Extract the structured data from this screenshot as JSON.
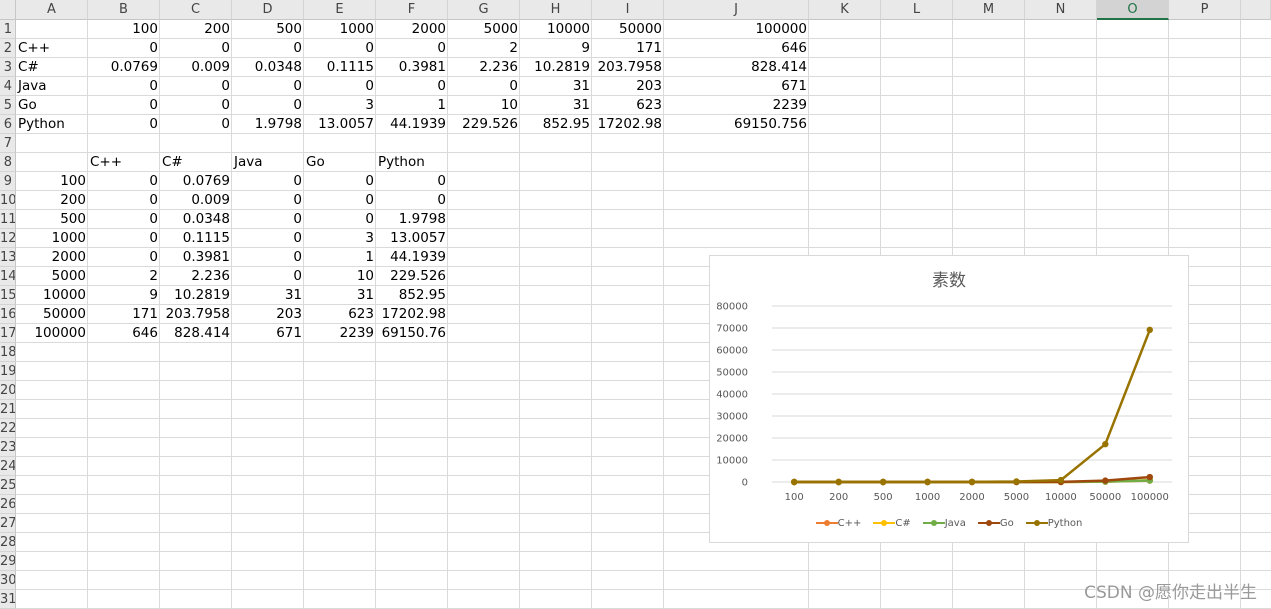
{
  "sheet": {
    "columns": [
      "A",
      "B",
      "C",
      "D",
      "E",
      "F",
      "G",
      "H",
      "I",
      "J",
      "K",
      "L",
      "M",
      "N",
      "O",
      "P"
    ],
    "active_column": "O",
    "rows": [
      "1",
      "2",
      "3",
      "4",
      "5",
      "6",
      "7",
      "8",
      "9",
      "10",
      "11",
      "12",
      "13",
      "14",
      "15",
      "16",
      "17",
      "18",
      "19",
      "20",
      "21",
      "22",
      "23",
      "24",
      "25",
      "26",
      "27",
      "28",
      "29",
      "30",
      "31"
    ],
    "table1": [
      [
        "",
        "100",
        "200",
        "500",
        "1000",
        "2000",
        "5000",
        "10000",
        "50000",
        "100000"
      ],
      [
        "C++",
        "0",
        "0",
        "0",
        "0",
        "0",
        "2",
        "9",
        "171",
        "646"
      ],
      [
        "C#",
        "0.0769",
        "0.009",
        "0.0348",
        "0.1115",
        "0.3981",
        "2.236",
        "10.2819",
        "203.7958",
        "828.414"
      ],
      [
        "Java",
        "0",
        "0",
        "0",
        "0",
        "0",
        "0",
        "31",
        "203",
        "671"
      ],
      [
        "Go",
        "0",
        "0",
        "0",
        "3",
        "1",
        "10",
        "31",
        "623",
        "2239"
      ],
      [
        "Python",
        "0",
        "0",
        "1.9798",
        "13.0057",
        "44.1939",
        "229.526",
        "852.95",
        "17202.98",
        "69150.756"
      ]
    ],
    "table2_header": [
      "",
      "C++",
      "C#",
      "Java",
      "Go",
      "Python"
    ],
    "table2": [
      [
        "100",
        "0",
        "0.0769",
        "0",
        "0",
        "0"
      ],
      [
        "200",
        "0",
        "0.009",
        "0",
        "0",
        "0"
      ],
      [
        "500",
        "0",
        "0.0348",
        "0",
        "0",
        "1.9798"
      ],
      [
        "1000",
        "0",
        "0.1115",
        "0",
        "3",
        "13.0057"
      ],
      [
        "2000",
        "0",
        "0.3981",
        "0",
        "1",
        "44.1939"
      ],
      [
        "5000",
        "2",
        "2.236",
        "0",
        "10",
        "229.526"
      ],
      [
        "10000",
        "9",
        "10.2819",
        "31",
        "31",
        "852.95"
      ],
      [
        "50000",
        "171",
        "203.7958",
        "203",
        "623",
        "17202.98"
      ],
      [
        "100000",
        "646",
        "828.414",
        "671",
        "2239",
        "69150.76"
      ]
    ]
  },
  "chart_data": {
    "type": "line",
    "title": "素数",
    "categories": [
      "100",
      "200",
      "500",
      "1000",
      "2000",
      "5000",
      "10000",
      "50000",
      "100000"
    ],
    "ylim": [
      0,
      80000
    ],
    "yticks": [
      "0",
      "10000",
      "20000",
      "30000",
      "40000",
      "50000",
      "60000",
      "70000",
      "80000"
    ],
    "grid": true,
    "legend_position": "bottom",
    "series": [
      {
        "name": "C++",
        "color": "#ED7D31",
        "values": [
          0,
          0,
          0,
          0,
          0,
          2,
          9,
          171,
          646
        ]
      },
      {
        "name": "C#",
        "color": "#FFC000",
        "values": [
          0.0769,
          0.009,
          0.0348,
          0.1115,
          0.3981,
          2.236,
          10.2819,
          203.7958,
          828.414
        ]
      },
      {
        "name": "Java",
        "color": "#70AD47",
        "values": [
          0,
          0,
          0,
          0,
          0,
          0,
          31,
          203,
          671
        ]
      },
      {
        "name": "Go",
        "color": "#9E480E",
        "values": [
          0,
          0,
          0,
          3,
          1,
          10,
          31,
          623,
          2239
        ]
      },
      {
        "name": "Python",
        "color": "#997300",
        "values": [
          0,
          0,
          1.9798,
          13.0057,
          44.1939,
          229.526,
          852.95,
          17202.98,
          69150.756
        ]
      }
    ]
  },
  "watermark": "CSDN @愿你走出半生"
}
